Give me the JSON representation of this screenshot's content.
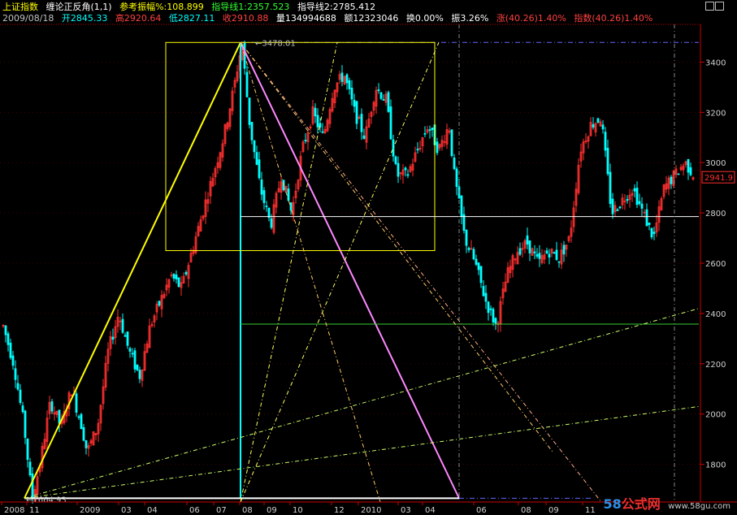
{
  "header": {
    "index_name": "上证指数",
    "indicator_name": "缠论正反角(1,1)",
    "amplitude_label": "参考振幅%:108.899",
    "guide1_label": "指导线1:2357.523",
    "guide2_label": "指导线2:2785.412",
    "date": "2009/08/18",
    "open": "开2845.33",
    "high": "高2920.64",
    "low": "低2827.11",
    "close": "收2910.88",
    "volume": "量134994688",
    "amount": "额12323046",
    "turnover": "换0.00%",
    "amplitude": "振3.26%",
    "change": "涨(40.26)1.40%",
    "index_change": "指数(40.26)1.40%"
  },
  "colors": {
    "up_candle": "#ff3030",
    "down_candle": "#00ffff",
    "axis": "#cc0000",
    "peak_box": "#ffff00",
    "guide1": "#33cc33",
    "guide2": "#ffffff",
    "price_tag": "#ff3030"
  },
  "chart_data": {
    "type": "candlestick",
    "title": "",
    "ylim": [
      1650,
      3550
    ],
    "y_ticks": [
      1800,
      2000,
      2200,
      2400,
      2600,
      2800,
      3000,
      3200,
      3400
    ],
    "x_ticks": [
      "2008",
      "11",
      "2009",
      "03",
      "04",
      "06",
      "07",
      "08",
      "09",
      "10",
      "12",
      "2010",
      "03",
      "04",
      "06",
      "08",
      "09",
      "11"
    ],
    "current_price": "2941.9",
    "low_label": "1664.93",
    "high_label": "3478.01",
    "low_value": 1664.93,
    "high_value": 3478.01,
    "guide1_value": 2357.523,
    "guide2_value": 2785.412,
    "close_path": [
      [
        0,
        2350
      ],
      [
        0.02,
        2200
      ],
      [
        0.04,
        1950
      ],
      [
        0.055,
        1664.93
      ],
      [
        0.07,
        1800
      ],
      [
        0.09,
        2050
      ],
      [
        0.11,
        1950
      ],
      [
        0.13,
        2100
      ],
      [
        0.15,
        1950
      ],
      [
        0.16,
        1850
      ],
      [
        0.18,
        1950
      ],
      [
        0.2,
        2250
      ],
      [
        0.22,
        2400
      ],
      [
        0.24,
        2250
      ],
      [
        0.26,
        2150
      ],
      [
        0.28,
        2350
      ],
      [
        0.3,
        2450
      ],
      [
        0.32,
        2550
      ],
      [
        0.34,
        2500
      ],
      [
        0.36,
        2650
      ],
      [
        0.38,
        2800
      ],
      [
        0.4,
        2950
      ],
      [
        0.42,
        3100
      ],
      [
        0.44,
        3300
      ],
      [
        0.455,
        3478.01
      ],
      [
        0.47,
        3150
      ],
      [
        0.49,
        2900
      ],
      [
        0.51,
        2750
      ],
      [
        0.53,
        2950
      ],
      [
        0.55,
        2800
      ],
      [
        0.57,
        3050
      ],
      [
        0.59,
        3200
      ],
      [
        0.61,
        3100
      ],
      [
        0.63,
        3300
      ],
      [
        0.65,
        3350
      ],
      [
        0.67,
        3200
      ],
      [
        0.69,
        3100
      ],
      [
        0.71,
        3300
      ],
      [
        0.73,
        3250
      ],
      [
        0.75,
        2950
      ],
      [
        0.77,
        2950
      ],
      [
        0.79,
        3050
      ],
      [
        0.81,
        3150
      ],
      [
        0.83,
        3050
      ],
      [
        0.85,
        3150
      ],
      [
        0.86,
        2950
      ],
      [
        0.88,
        2700
      ],
      [
        0.9,
        2600
      ],
      [
        0.92,
        2450
      ],
      [
        0.94,
        2350
      ],
      [
        0.96,
        2550
      ],
      [
        0.98,
        2650
      ],
      [
        1.0,
        2680
      ],
      [
        1.02,
        2600
      ],
      [
        1.04,
        2650
      ],
      [
        1.06,
        2620
      ],
      [
        1.08,
        2700
      ],
      [
        1.1,
        3050
      ],
      [
        1.12,
        3150
      ],
      [
        1.14,
        3180
      ],
      [
        1.16,
        2800
      ],
      [
        1.18,
        2850
      ],
      [
        1.2,
        2900
      ],
      [
        1.22,
        2800
      ],
      [
        1.24,
        2700
      ],
      [
        1.26,
        2900
      ],
      [
        1.28,
        2950
      ],
      [
        1.3,
        3000
      ],
      [
        1.32,
        2941.9
      ]
    ]
  },
  "watermark": {
    "brand": "58公式网",
    "url": "www.58gu.com"
  }
}
